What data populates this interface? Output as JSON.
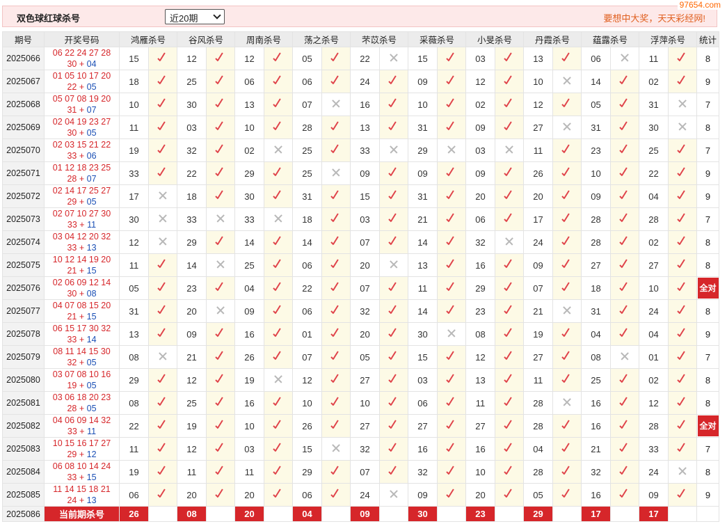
{
  "header": {
    "title": "双色球红球杀号",
    "period_select": "近20期",
    "slogan": "要想中大奖，天天彩经网!",
    "watermark": "97654.com"
  },
  "columns": {
    "issue": "期号",
    "numbers": "开奖号码",
    "experts": [
      "鸿雁杀号",
      "谷风杀号",
      "周南杀号",
      "荡之杀号",
      "芣苡杀号",
      "采薇杀号",
      "小旻杀号",
      "丹霞杀号",
      "蕴露杀号",
      "浮萍杀号"
    ],
    "stat": "统计"
  },
  "rows": [
    {
      "issue": "2025066",
      "red": "06 22 24 27 28",
      "red2": "30",
      "blue": "04",
      "kills": [
        [
          "15",
          1
        ],
        [
          "12",
          1
        ],
        [
          "12",
          1
        ],
        [
          "05",
          1
        ],
        [
          "22",
          0
        ],
        [
          "15",
          1
        ],
        [
          "03",
          1
        ],
        [
          "13",
          1
        ],
        [
          "06",
          0
        ],
        [
          "11",
          1
        ]
      ],
      "stat": "8"
    },
    {
      "issue": "2025067",
      "red": "01 05 10 17 20",
      "red2": "22",
      "blue": "05",
      "kills": [
        [
          "18",
          1
        ],
        [
          "25",
          1
        ],
        [
          "06",
          1
        ],
        [
          "06",
          1
        ],
        [
          "24",
          1
        ],
        [
          "09",
          1
        ],
        [
          "12",
          1
        ],
        [
          "10",
          0
        ],
        [
          "14",
          1
        ],
        [
          "02",
          1
        ]
      ],
      "stat": "9"
    },
    {
      "issue": "2025068",
      "red": "05 07 08 19 20",
      "red2": "31",
      "blue": "07",
      "kills": [
        [
          "10",
          1
        ],
        [
          "30",
          1
        ],
        [
          "13",
          1
        ],
        [
          "07",
          0
        ],
        [
          "16",
          1
        ],
        [
          "10",
          1
        ],
        [
          "02",
          1
        ],
        [
          "12",
          1
        ],
        [
          "05",
          1
        ],
        [
          "31",
          0
        ]
      ],
      "stat": "7"
    },
    {
      "issue": "2025069",
      "red": "02 04 19 23 27",
      "red2": "30",
      "blue": "05",
      "kills": [
        [
          "11",
          1
        ],
        [
          "03",
          1
        ],
        [
          "10",
          1
        ],
        [
          "28",
          1
        ],
        [
          "13",
          1
        ],
        [
          "31",
          1
        ],
        [
          "09",
          1
        ],
        [
          "27",
          0
        ],
        [
          "31",
          1
        ],
        [
          "30",
          0
        ]
      ],
      "stat": "8"
    },
    {
      "issue": "2025070",
      "red": "02 03 15 21 22",
      "red2": "33",
      "blue": "06",
      "kills": [
        [
          "19",
          1
        ],
        [
          "32",
          1
        ],
        [
          "02",
          0
        ],
        [
          "25",
          1
        ],
        [
          "33",
          0
        ],
        [
          "29",
          0
        ],
        [
          "03",
          0
        ],
        [
          "11",
          1
        ],
        [
          "23",
          1
        ],
        [
          "25",
          1
        ]
      ],
      "stat": "7"
    },
    {
      "issue": "2025071",
      "red": "01 12 18 23 25",
      "red2": "28",
      "blue": "07",
      "kills": [
        [
          "33",
          1
        ],
        [
          "22",
          1
        ],
        [
          "29",
          1
        ],
        [
          "25",
          0
        ],
        [
          "09",
          1
        ],
        [
          "09",
          1
        ],
        [
          "09",
          1
        ],
        [
          "26",
          1
        ],
        [
          "10",
          1
        ],
        [
          "22",
          1
        ]
      ],
      "stat": "9"
    },
    {
      "issue": "2025072",
      "red": "02 14 17 25 27",
      "red2": "29",
      "blue": "05",
      "kills": [
        [
          "17",
          0
        ],
        [
          "18",
          1
        ],
        [
          "30",
          1
        ],
        [
          "31",
          1
        ],
        [
          "15",
          1
        ],
        [
          "31",
          1
        ],
        [
          "20",
          1
        ],
        [
          "20",
          1
        ],
        [
          "09",
          1
        ],
        [
          "04",
          1
        ]
      ],
      "stat": "9"
    },
    {
      "issue": "2025073",
      "red": "02 07 10 27 30",
      "red2": "33",
      "blue": "11",
      "kills": [
        [
          "30",
          0
        ],
        [
          "33",
          0
        ],
        [
          "33",
          0
        ],
        [
          "18",
          1
        ],
        [
          "03",
          1
        ],
        [
          "21",
          1
        ],
        [
          "06",
          1
        ],
        [
          "17",
          1
        ],
        [
          "28",
          1
        ],
        [
          "28",
          1
        ]
      ],
      "stat": "7"
    },
    {
      "issue": "2025074",
      "red": "03 04 12 20 32",
      "red2": "33",
      "blue": "13",
      "kills": [
        [
          "12",
          0
        ],
        [
          "29",
          1
        ],
        [
          "14",
          1
        ],
        [
          "14",
          1
        ],
        [
          "07",
          1
        ],
        [
          "14",
          1
        ],
        [
          "32",
          0
        ],
        [
          "24",
          1
        ],
        [
          "28",
          1
        ],
        [
          "02",
          1
        ]
      ],
      "stat": "8"
    },
    {
      "issue": "2025075",
      "red": "10 12 14 19 20",
      "red2": "21",
      "blue": "15",
      "kills": [
        [
          "11",
          1
        ],
        [
          "14",
          0
        ],
        [
          "25",
          1
        ],
        [
          "06",
          1
        ],
        [
          "20",
          0
        ],
        [
          "13",
          1
        ],
        [
          "16",
          1
        ],
        [
          "09",
          1
        ],
        [
          "27",
          1
        ],
        [
          "27",
          1
        ]
      ],
      "stat": "8"
    },
    {
      "issue": "2025076",
      "red": "02 06 09 12 14",
      "red2": "30",
      "blue": "08",
      "kills": [
        [
          "05",
          1
        ],
        [
          "23",
          1
        ],
        [
          "04",
          1
        ],
        [
          "22",
          1
        ],
        [
          "07",
          1
        ],
        [
          "11",
          1
        ],
        [
          "29",
          1
        ],
        [
          "07",
          1
        ],
        [
          "18",
          1
        ],
        [
          "10",
          1
        ]
      ],
      "stat": "全对"
    },
    {
      "issue": "2025077",
      "red": "04 07 08 15 20",
      "red2": "21",
      "blue": "15",
      "kills": [
        [
          "31",
          1
        ],
        [
          "20",
          0
        ],
        [
          "09",
          1
        ],
        [
          "06",
          1
        ],
        [
          "32",
          1
        ],
        [
          "14",
          1
        ],
        [
          "23",
          1
        ],
        [
          "21",
          0
        ],
        [
          "31",
          1
        ],
        [
          "24",
          1
        ]
      ],
      "stat": "8"
    },
    {
      "issue": "2025078",
      "red": "06 15 17 30 32",
      "red2": "33",
      "blue": "14",
      "kills": [
        [
          "13",
          1
        ],
        [
          "09",
          1
        ],
        [
          "16",
          1
        ],
        [
          "01",
          1
        ],
        [
          "20",
          1
        ],
        [
          "30",
          0
        ],
        [
          "08",
          1
        ],
        [
          "19",
          1
        ],
        [
          "04",
          1
        ],
        [
          "04",
          1
        ]
      ],
      "stat": "9"
    },
    {
      "issue": "2025079",
      "red": "08 11 14 15 30",
      "red2": "32",
      "blue": "05",
      "kills": [
        [
          "08",
          0
        ],
        [
          "21",
          1
        ],
        [
          "26",
          1
        ],
        [
          "07",
          1
        ],
        [
          "05",
          1
        ],
        [
          "15",
          1
        ],
        [
          "12",
          1
        ],
        [
          "27",
          1
        ],
        [
          "08",
          0
        ],
        [
          "01",
          1
        ]
      ],
      "stat": "7"
    },
    {
      "issue": "2025080",
      "red": "03 07 08 10 16",
      "red2": "19",
      "blue": "05",
      "kills": [
        [
          "29",
          1
        ],
        [
          "12",
          1
        ],
        [
          "19",
          0
        ],
        [
          "12",
          1
        ],
        [
          "27",
          1
        ],
        [
          "03",
          1
        ],
        [
          "13",
          1
        ],
        [
          "11",
          1
        ],
        [
          "25",
          1
        ],
        [
          "02",
          1
        ]
      ],
      "stat": "8"
    },
    {
      "issue": "2025081",
      "red": "03 06 18 20 23",
      "red2": "28",
      "blue": "05",
      "kills": [
        [
          "08",
          1
        ],
        [
          "25",
          1
        ],
        [
          "16",
          1
        ],
        [
          "10",
          1
        ],
        [
          "10",
          1
        ],
        [
          "06",
          1
        ],
        [
          "11",
          1
        ],
        [
          "28",
          0
        ],
        [
          "16",
          1
        ],
        [
          "12",
          1
        ]
      ],
      "stat": "8"
    },
    {
      "issue": "2025082",
      "red": "04 06 09 14 32",
      "red2": "33",
      "blue": "11",
      "kills": [
        [
          "22",
          1
        ],
        [
          "19",
          1
        ],
        [
          "10",
          1
        ],
        [
          "26",
          1
        ],
        [
          "27",
          1
        ],
        [
          "27",
          1
        ],
        [
          "27",
          1
        ],
        [
          "28",
          1
        ],
        [
          "16",
          1
        ],
        [
          "28",
          1
        ]
      ],
      "stat": "全对"
    },
    {
      "issue": "2025083",
      "red": "10 15 16 17 27",
      "red2": "29",
      "blue": "12",
      "kills": [
        [
          "11",
          1
        ],
        [
          "12",
          1
        ],
        [
          "03",
          1
        ],
        [
          "15",
          0
        ],
        [
          "32",
          1
        ],
        [
          "16",
          1
        ],
        [
          "16",
          1
        ],
        [
          "04",
          1
        ],
        [
          "21",
          1
        ],
        [
          "33",
          1
        ]
      ],
      "stat": "7"
    },
    {
      "issue": "2025084",
      "red": "06 08 10 14 24",
      "red2": "33",
      "blue": "15",
      "kills": [
        [
          "19",
          1
        ],
        [
          "11",
          1
        ],
        [
          "11",
          1
        ],
        [
          "29",
          1
        ],
        [
          "07",
          1
        ],
        [
          "32",
          1
        ],
        [
          "10",
          1
        ],
        [
          "28",
          1
        ],
        [
          "32",
          1
        ],
        [
          "24",
          0
        ]
      ],
      "stat": "8"
    },
    {
      "issue": "2025085",
      "red": "11 14 15 18 21",
      "red2": "24",
      "blue": "13",
      "kills": [
        [
          "06",
          1
        ],
        [
          "20",
          1
        ],
        [
          "20",
          1
        ],
        [
          "06",
          1
        ],
        [
          "24",
          0
        ],
        [
          "09",
          1
        ],
        [
          "20",
          1
        ],
        [
          "05",
          1
        ],
        [
          "16",
          1
        ],
        [
          "09",
          1
        ]
      ],
      "stat": "9"
    }
  ],
  "current": {
    "issue": "2025086",
    "label": "当前期杀号",
    "kills": [
      "26",
      "08",
      "20",
      "04",
      "09",
      "30",
      "23",
      "29",
      "17",
      "17"
    ]
  }
}
